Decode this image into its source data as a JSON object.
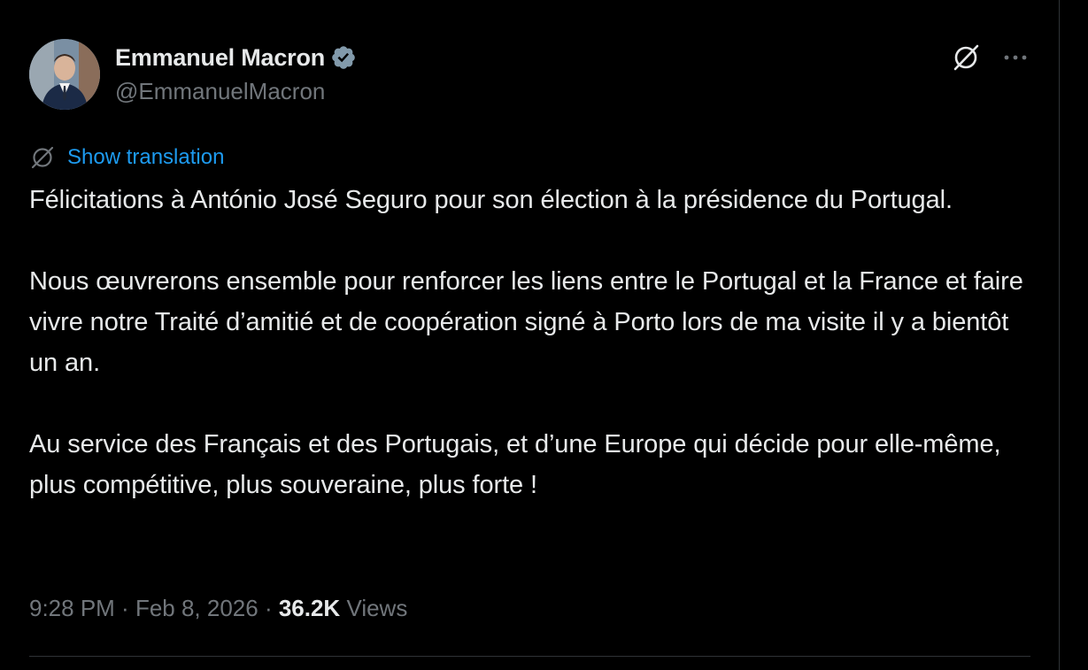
{
  "author": {
    "display_name": "Emmanuel Macron",
    "handle": "@EmmanuelMacron",
    "verified": true,
    "verified_color": "#829aab"
  },
  "header_actions": {
    "grok_icon": "grok-icon",
    "more_icon": "more-horizontal-icon"
  },
  "translation": {
    "icon": "translate-icon",
    "label": "Show translation"
  },
  "tweet": {
    "paragraphs": [
      "Félicitations à António José Seguro pour son élection à la présidence du Portugal.",
      "Nous œuvrerons ensemble pour renforcer les liens entre le Portugal et la France et faire vivre notre Traité d’amitié et de coopération signé à Porto lors de ma visite il y a bientôt un an.",
      "Au service des Français et des Portugais, et d’une Europe qui décide pour elle-même, plus compétitive, plus souveraine, plus forte !"
    ]
  },
  "meta": {
    "time": "9:28 PM",
    "separator": " · ",
    "date": "Feb 8, 2026",
    "views_count": "36.2K",
    "views_label": " Views"
  },
  "colors": {
    "background": "#000000",
    "text": "#e7e9ea",
    "secondary": "#71767b",
    "link": "#1d9bf0",
    "border": "#2f3336"
  }
}
